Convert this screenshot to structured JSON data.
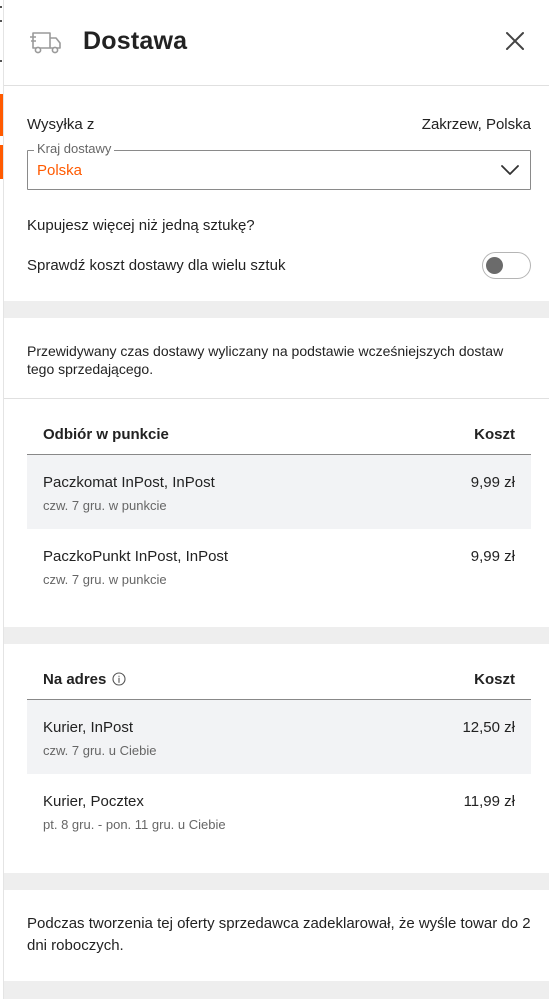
{
  "modal": {
    "title": "Dostawa",
    "icon": "truck-icon",
    "close_icon": "close-icon"
  },
  "shipping_from": {
    "label": "Wysyłka z",
    "value": "Zakrzew, Polska"
  },
  "country_select": {
    "legend": "Kraj dostawy",
    "value": "Polska"
  },
  "multi": {
    "question": "Kupujesz więcej niż jedną sztukę?",
    "toggle_label": "Sprawdź koszt dostawy dla wielu sztuk",
    "toggle_on": false
  },
  "estimate_note": "Przewidywany czas dostawy wyliczany na podstawie wcześniejszych dostaw tego sprzedającego.",
  "pickup_table": {
    "header": "Odbiór w punkcie",
    "cost_header": "Koszt",
    "rows": [
      {
        "name": "Paczkomat InPost, InPost",
        "sub": "czw. 7 gru. w punkcie",
        "price": "9,99 zł"
      },
      {
        "name": "PaczkoPunkt InPost, InPost",
        "sub": "czw. 7 gru. w punkcie",
        "price": "9,99 zł"
      }
    ]
  },
  "address_table": {
    "header": "Na adres",
    "cost_header": "Koszt",
    "rows": [
      {
        "name": "Kurier, InPost",
        "sub": "czw. 7 gru. u Ciebie",
        "price": "12,50 zł"
      },
      {
        "name": "Kurier, Pocztex",
        "sub": "pt. 8 gru. - pon. 11 gru. u Ciebie",
        "price": "11,99 zł"
      }
    ]
  },
  "seller_note": "Podczas tworzenia tej oferty sprzedawca zadeklarował, że wyśle towar do 2 dni roboczych.",
  "colors": {
    "accent": "#ff5a00",
    "band": "#eeeeee",
    "row_shade": "#f2f3f5"
  }
}
